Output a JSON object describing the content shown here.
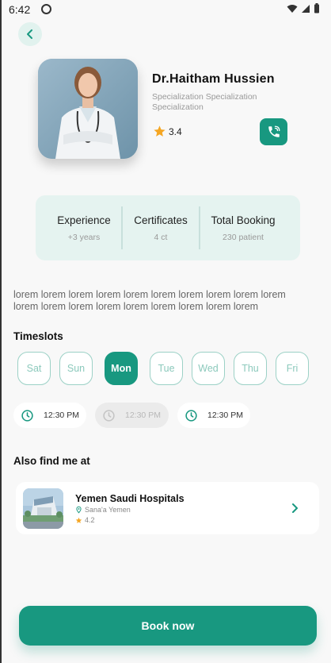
{
  "status_bar": {
    "time": "6:42"
  },
  "doctor": {
    "name": "Dr.Haitham Hussien",
    "specialization_line1": "Specialization Specialization",
    "specialization_line2": "Specialization",
    "rating": "3.4"
  },
  "stats": [
    {
      "label": "Experience",
      "value": "+3 years"
    },
    {
      "label": "Certificates",
      "value": "4 ct"
    },
    {
      "label": "Total Booking",
      "value": "230 patient"
    }
  ],
  "about": {
    "line1": "lorem lorem lorem lorem lorem lorem lorem lorem lorem lorem",
    "line2": "lorem lorem lorem lorem lorem lorem lorem lorem lorem"
  },
  "timeslots": {
    "title": "Timeslots",
    "days": [
      {
        "label": "Sat",
        "selected": false
      },
      {
        "label": "Sun",
        "selected": false
      },
      {
        "label": "Mon",
        "selected": true
      },
      {
        "label": "Tue",
        "selected": false
      },
      {
        "label": "Wed",
        "selected": false
      },
      {
        "label": "Thu",
        "selected": false
      },
      {
        "label": "Fri",
        "selected": false
      }
    ],
    "times": [
      {
        "label": "12:30 PM",
        "available": true
      },
      {
        "label": "12:30 PM",
        "available": false
      },
      {
        "label": "12:30 PM",
        "available": true
      }
    ]
  },
  "also_find": {
    "title": "Also find me at",
    "hospital": {
      "name": "Yemen Saudi Hospitals",
      "location": "Sana'a Yemen",
      "rating": "4.2"
    }
  },
  "book_button": {
    "label": "Book now"
  },
  "colors": {
    "primary": "#189880",
    "primary_light": "#e5f3f0",
    "chip_border": "#9cd1c6",
    "star": "#f5a623"
  },
  "icons": {
    "back": "chevron-left-icon",
    "call": "phone-call-icon",
    "rating": "star-icon",
    "clock": "clock-icon",
    "location": "map-pin-icon",
    "hospital_open": "chevron-right-icon"
  }
}
